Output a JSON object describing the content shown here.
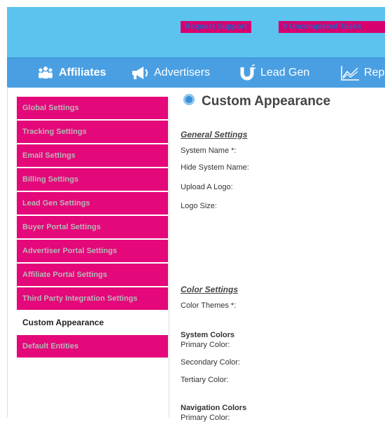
{
  "topbar": {
    "request_support": "Request Support",
    "uncompleted_tasks": "0  Uncompleted Tasks"
  },
  "nav": {
    "items": [
      {
        "label": "Affiliates",
        "icon": "users-icon"
      },
      {
        "label": "Advertisers",
        "icon": "megaphone-icon"
      },
      {
        "label": "Lead Gen",
        "icon": "magnet-icon"
      },
      {
        "label": "Rep",
        "icon": "chart-icon"
      }
    ]
  },
  "sidebar": {
    "items": [
      {
        "label": "Global Settings",
        "active": false
      },
      {
        "label": "Tracking Settings",
        "active": false
      },
      {
        "label": "Email Settings",
        "active": false
      },
      {
        "label": "Billing Settings",
        "active": false
      },
      {
        "label": "Lead Gen Settings",
        "active": false
      },
      {
        "label": "Buyer Portal Settings",
        "active": false
      },
      {
        "label": "Advertiser Portal Settings",
        "active": false
      },
      {
        "label": "Affiliate Portal Settings",
        "active": false
      },
      {
        "label": "Third Party Integration Settings",
        "active": false
      },
      {
        "label": "Custom Appearance",
        "active": true
      },
      {
        "label": "Default Entities",
        "active": false
      }
    ]
  },
  "main": {
    "title": "Custom Appearance",
    "general_heading": "General Settings",
    "system_name": "System Name *:",
    "hide_system_name": "Hide System Name:",
    "upload_logo": "Upload A Logo:",
    "logo_size": "Logo Size:",
    "color_heading": "Color Settings",
    "color_themes": "Color Themes *:",
    "system_colors": "System Colors",
    "primary_color": "Primary Color:",
    "secondary_color": "Secondary Color:",
    "tertiary_color": "Tertiary Color:",
    "navigation_colors": "Navigation Colors",
    "nav_primary_color": "Primary Color:"
  },
  "colors": {
    "topbar": "#5bc3ee",
    "navbar": "#4a9fe2",
    "accent_pink": "#e4087a"
  }
}
